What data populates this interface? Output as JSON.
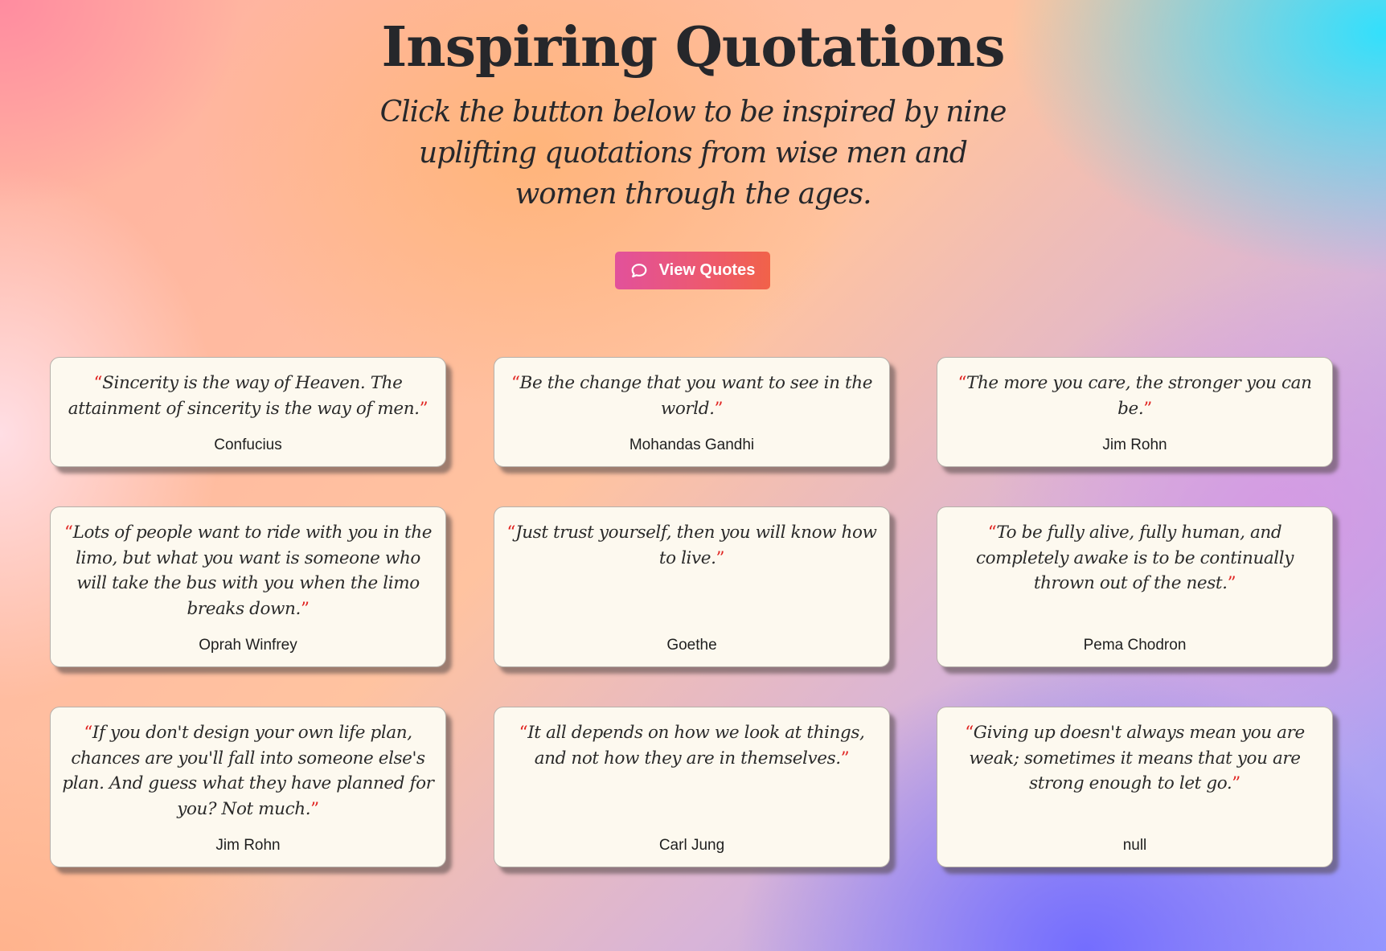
{
  "header": {
    "title": "Inspiring Quotations",
    "subtitle": "Click the button below to be inspired by nine uplifting quotations from wise men and women through the ages."
  },
  "button": {
    "label": "View Quotes",
    "icon": "speech-bubble-icon"
  },
  "quote_marks": {
    "open": "“",
    "close": "”",
    "color": "#e0221f"
  },
  "quotes": [
    {
      "text": "Sincerity is the way of Heaven. The attainment of sincerity is the way of men.",
      "author": "Confucius"
    },
    {
      "text": "Be the change that you want to see in the world.",
      "author": "Mohandas Gandhi"
    },
    {
      "text": "The more you care, the stronger you can be.",
      "author": "Jim Rohn"
    },
    {
      "text": "Lots of people want to ride with you in the limo, but what you want is someone who will take the bus with you when the limo breaks down.",
      "author": "Oprah Winfrey"
    },
    {
      "text": "Just trust yourself, then you will know how to live.",
      "author": "Goethe"
    },
    {
      "text": "To be fully alive, fully human, and completely awake is to be continually thrown out of the nest.",
      "author": "Pema Chodron"
    },
    {
      "text": "If you don't design your own life plan, chances are you'll fall into someone else's plan. And guess what they have planned for you? Not much.",
      "author": "Jim Rohn"
    },
    {
      "text": "It all depends on how we look at things, and not how they are in themselves.",
      "author": "Carl Jung"
    },
    {
      "text": "Giving up doesn't always mean you are weak; sometimes it means that you are strong enough to let go.",
      "author": "null"
    }
  ]
}
